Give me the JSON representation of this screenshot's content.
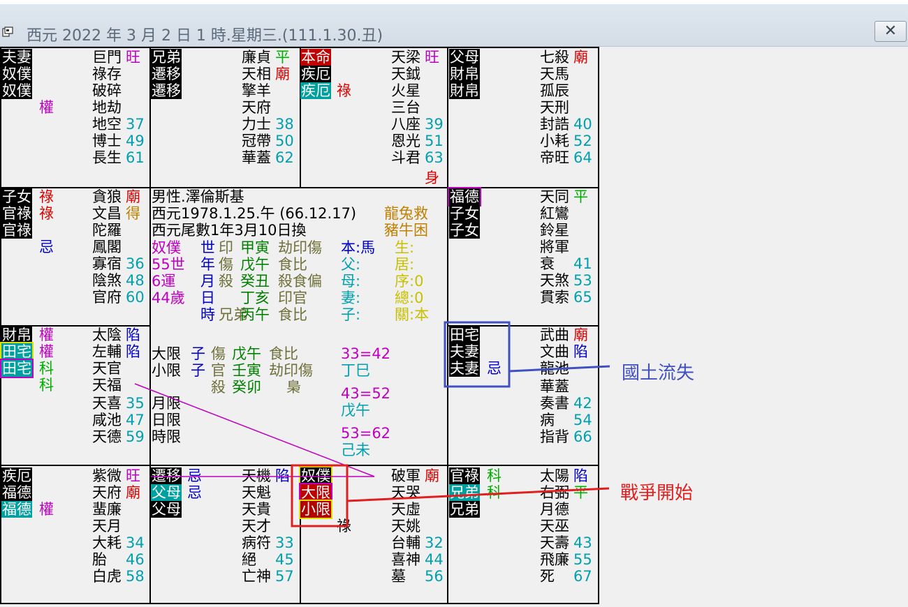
{
  "window": {
    "title": "西元 2022 年 3 月 2 日 1 時.星期三.(111.1.30.丑)",
    "close_glyph": "✕"
  },
  "palaces": {
    "tl": {
      "labels": [
        "夫妻",
        "奴僕",
        "奴僕"
      ],
      "hua": "權",
      "stars": [
        "巨門",
        "祿存",
        "破碎",
        "地劫",
        "地空",
        "博士",
        "長生"
      ],
      "brightness": "旺",
      "nums": [
        "37",
        "49",
        "61"
      ]
    },
    "tm1": {
      "labels": [
        "兄弟",
        "遷移",
        "遷移"
      ],
      "stars": [
        "廉貞",
        "天相",
        "擎羊",
        "天府",
        "力士",
        "冠帶",
        "華蓋"
      ],
      "brightness": [
        "平",
        "廟"
      ],
      "nums": [
        "38",
        "50",
        "62"
      ]
    },
    "tm2": {
      "labels": [
        "本命",
        "疾厄",
        "疾厄"
      ],
      "hua": "祿",
      "stars": [
        "天梁",
        "天鉞",
        "火星",
        "三台",
        "八座",
        "恩光",
        "斗君"
      ],
      "brightness": "旺",
      "nums": [
        "39",
        "51",
        "63"
      ],
      "shen": "身"
    },
    "tr": {
      "labels": [
        "父母",
        "財帛",
        "財帛"
      ],
      "stars": [
        "七殺",
        "天馬",
        "孤辰",
        "天刑",
        "封誥",
        "小耗",
        "帝旺"
      ],
      "brightness": "廟",
      "nums": [
        "40",
        "52",
        "64"
      ]
    },
    "ml": {
      "labels": [
        "子女",
        "官祿",
        "官祿"
      ],
      "hua": [
        "祿",
        "祿",
        "忌"
      ],
      "stars": [
        "貪狼",
        "文昌",
        "陀羅",
        "鳳閣",
        "寡宿",
        "陰煞",
        "官府"
      ],
      "brightness": [
        "廟",
        "得"
      ],
      "nums": [
        "36",
        "48",
        "60"
      ]
    },
    "mr": {
      "labels": [
        "福德",
        "子女",
        "子女"
      ],
      "stars": [
        "天同",
        "紅鸞",
        "鈴星",
        "將軍",
        "衰",
        "天煞",
        "貫索"
      ],
      "brightness": "平",
      "nums": [
        "41",
        "53",
        "65"
      ]
    },
    "ml2": {
      "labels": [
        "財帛",
        "田宅",
        "田宅"
      ],
      "hua": [
        "權",
        "權",
        "科",
        "科"
      ],
      "stars": [
        "太陰",
        "左輔",
        "天官",
        "天福",
        "天喜",
        "咸池",
        "天德"
      ],
      "brightness": [
        "陷",
        "陷"
      ],
      "nums": [
        "35",
        "47",
        "59"
      ]
    },
    "mr2": {
      "labels": [
        "田宅",
        "夫妻",
        "夫妻"
      ],
      "hua": "忌",
      "stars": [
        "武曲",
        "文曲",
        "龍池",
        "華蓋",
        "奏書",
        "病",
        "指背"
      ],
      "brightness": [
        "廟",
        "陷"
      ],
      "nums": [
        "42",
        "54",
        "66"
      ]
    },
    "bl": {
      "labels": [
        "疾厄",
        "福德",
        "福德"
      ],
      "hua": "權",
      "stars": [
        "紫微",
        "天府",
        "蜚廉",
        "天月",
        "大耗",
        "胎",
        "白虎"
      ],
      "brightness": [
        "旺",
        "廟"
      ],
      "nums": [
        "34",
        "46",
        "58"
      ]
    },
    "bm1": {
      "labels": [
        "遷移",
        "父母",
        "父母"
      ],
      "hua": [
        "忌",
        "忌"
      ],
      "stars": [
        "天機",
        "天魁",
        "天貴",
        "天才",
        "病符",
        "絕",
        "亡神"
      ],
      "brightness": "陷",
      "nums": [
        "33",
        "45",
        "57"
      ]
    },
    "bm2": {
      "labels": [
        "奴僕",
        "大限",
        "小限"
      ],
      "hua": "祿",
      "stars": [
        "破軍",
        "天哭",
        "天虛",
        "天姚",
        "台輔",
        "喜神",
        "墓"
      ],
      "brightness": "廟",
      "nums": [
        "32",
        "44",
        "56"
      ]
    },
    "br": {
      "labels": [
        "官祿",
        "兄弟",
        "兄弟"
      ],
      "hua": [
        "科",
        "科"
      ],
      "stars": [
        "太陽",
        "右弼",
        "月德",
        "天巫",
        "天壽",
        "飛廉",
        "死"
      ],
      "brightness": [
        "陷",
        "平"
      ],
      "nums": [
        "43",
        "55",
        "67"
      ]
    }
  },
  "center": {
    "line1": "男性.澤倫斯基",
    "line2": "西元1978.1.25.午 (66.12.17)",
    "line3": "西元尾數1年3月10日換",
    "corner1": "龍兔救",
    "corner2": "豬牛困",
    "col_a": [
      "奴僕",
      "55世",
      "6運",
      "44歲"
    ],
    "col_b": [
      "世",
      "年",
      "月",
      "日",
      "時"
    ],
    "col_c": [
      "印",
      "傷",
      "殺",
      "",
      ""
    ],
    "col_d": [
      "甲寅",
      "戊午",
      "癸丑",
      "丁亥",
      "丙午"
    ],
    "col_e": [
      "劫印傷",
      "食比",
      "殺食偏",
      "印官",
      "食比"
    ],
    "col_f": [
      "本:馬",
      "父:",
      "母:",
      "妻:",
      "子:"
    ],
    "col_g": [
      "生:",
      "居:",
      "序:0",
      "總:0",
      "關:本"
    ],
    "big_limit": "大限",
    "small_limit": "小限",
    "bl_row1": [
      "子",
      "傷",
      "戊午",
      "食比"
    ],
    "bl_row2": [
      "子",
      "官",
      "壬寅",
      "劫印傷"
    ],
    "bl_row3": [
      "殺",
      "癸卯",
      "梟"
    ],
    "ages": [
      "33=42",
      "丁巳",
      "43=52",
      "戊午",
      "53=62",
      "己未"
    ],
    "month_limit": "月限",
    "day_limit": "日限",
    "hour_limit": "時限"
  },
  "annotations": {
    "blue_note": "國土流失",
    "red_note": "戰爭開始",
    "blue_color": "#4050c0",
    "red_color": "#e02020"
  }
}
